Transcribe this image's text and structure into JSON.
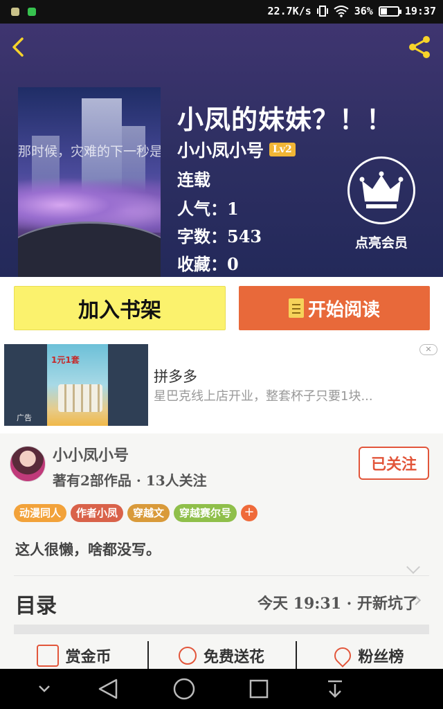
{
  "status_bar": {
    "net_speed": "22.7K/s",
    "battery": "36%",
    "battery_level": 0.36,
    "time": "19:37"
  },
  "book": {
    "title": "小凤的妹妹？！！",
    "cover_text": "那时候，灾难的下一秒是",
    "author": "小小凤小号",
    "level": "Lv2",
    "status": "连载",
    "popularity": "人气：1",
    "word_count": "字数：543",
    "favorites": "收藏：0"
  },
  "vip": {
    "label": "点亮会员"
  },
  "actions": {
    "add_shelf": "加入书架",
    "start_reading": "开始阅读"
  },
  "ad": {
    "image_caption": "1元1套",
    "tag": "广告",
    "close": "✕",
    "title": "拼多多",
    "description": "星巴克线上店开业，整套杯子只要1块..."
  },
  "author_card": {
    "name": "小小凤小号",
    "stats": "著有2部作品 · 13人关注",
    "follow_label": "已关注"
  },
  "tags": [
    {
      "label": "动漫同人",
      "color": "#f2a23a"
    },
    {
      "label": "作者小凤",
      "color": "#d9624a"
    },
    {
      "label": "穿越文",
      "color": "#d99a3a"
    },
    {
      "label": "穿越赛尔号",
      "color": "#8fbf4a"
    }
  ],
  "tag_add": "+",
  "intro": "这人很懒，啥都没写。",
  "toc": {
    "title": "目录",
    "latest": "今天 19:31 · 开新坑了"
  },
  "bottom_items": [
    {
      "label": "赏金币",
      "icon": "coin-icon"
    },
    {
      "label": "免费送花",
      "icon": "flower-icon"
    },
    {
      "label": "粉丝榜",
      "icon": "fans-icon"
    }
  ],
  "navbar": {
    "icons": [
      "chevron-down-icon",
      "back-icon",
      "home-icon",
      "recents-icon",
      "notification-pull-icon"
    ]
  }
}
